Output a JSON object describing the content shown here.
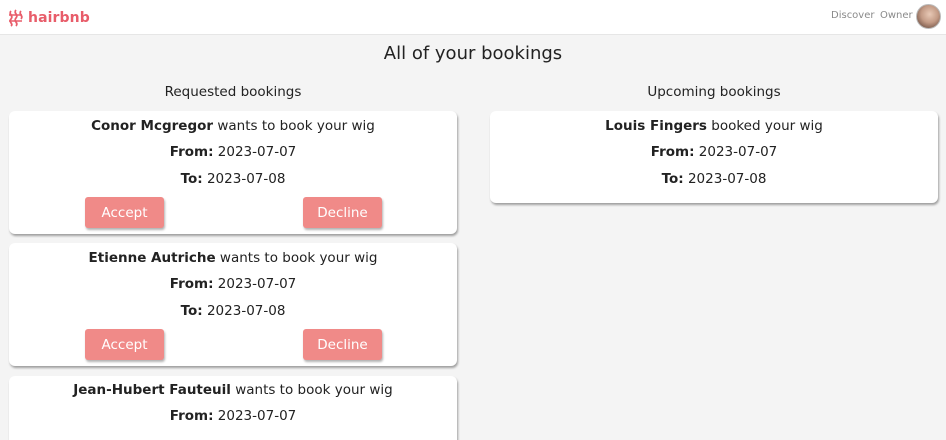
{
  "nav": {
    "brand": "hairbnb",
    "links": [
      "Discover",
      "Owner"
    ]
  },
  "page": {
    "title": "All of your bookings"
  },
  "requested": {
    "heading": "Requested bookings",
    "items": [
      {
        "name": "Conor Mcgregor",
        "text": " wants to book your wig",
        "from_label": "From:",
        "from": " 2023-07-07",
        "to_label": "To:",
        "to": " 2023-07-08",
        "accept": "Accept",
        "decline": "Decline"
      },
      {
        "name": "Etienne Autriche",
        "text": " wants to book your wig",
        "from_label": "From:",
        "from": " 2023-07-07",
        "to_label": "To:",
        "to": " 2023-07-08",
        "accept": "Accept",
        "decline": "Decline"
      },
      {
        "name": "Jean-Hubert Fauteuil",
        "text": " wants to book your wig",
        "from_label": "From:",
        "from": " 2023-07-07"
      }
    ]
  },
  "upcoming": {
    "heading": "Upcoming bookings",
    "items": [
      {
        "name": "Louis Fingers",
        "text": " booked your wig",
        "from_label": "From:",
        "from": " 2023-07-07",
        "to_label": "To:",
        "to": " 2023-07-08"
      }
    ]
  },
  "colors": {
    "brand": "#e85d6a",
    "button": "#f08a88",
    "background": "#f4f4f4"
  }
}
